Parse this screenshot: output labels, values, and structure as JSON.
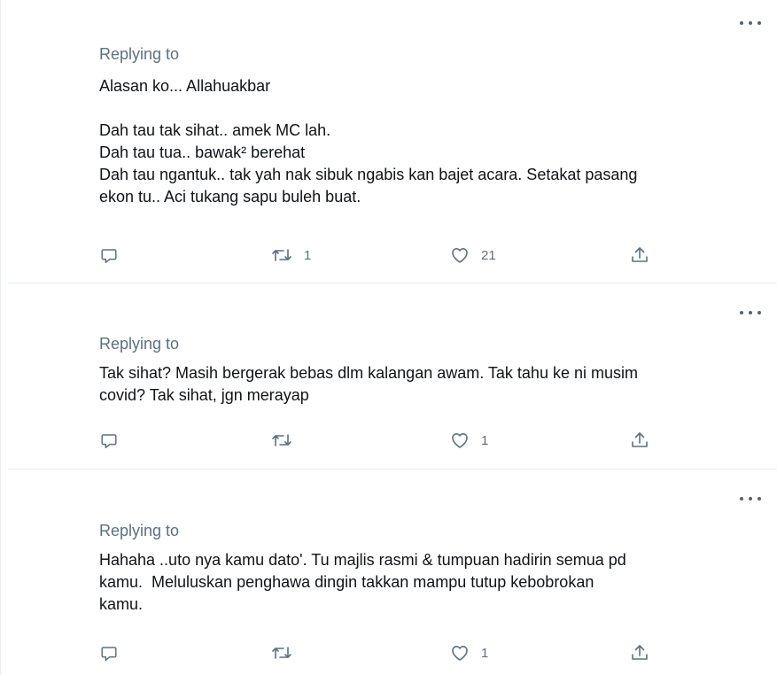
{
  "replies": [
    {
      "replying_to": "Replying to",
      "text": "Alasan ko... Allahuakbar\n\nDah tau tak sihat.. amek MC lah.\nDah tau tua.. bawak² berehat\nDah tau ngantuk.. tak yah nak sibuk ngabis kan bajet acara. Setakat pasang\nekon tu.. Aci tukang sapu buleh buat.",
      "retweets": "1",
      "likes": "21"
    },
    {
      "replying_to": "Replying to",
      "text": "Tak sihat? Masih bergerak bebas dlm kalangan awam. Tak tahu ke ni musim\ncovid? Tak sihat, jgn merayap",
      "retweets": "",
      "likes": "1"
    },
    {
      "replying_to": "Replying to",
      "text": "Hahaha ..uto nya kamu dato'. Tu majlis rasmi & tumpuan hadirin semua pd\nkamu.  Meluluskan penghawa dingin takkan mampu tutup kebobrokan\nkamu.",
      "retweets": "",
      "likes": "1"
    }
  ],
  "icons": {
    "more": "more-horizontal-icon",
    "reply": "reply-bubble-icon",
    "retweet": "retweet-icon",
    "like": "heart-icon",
    "share": "share-upload-icon"
  },
  "colors": {
    "text": "#0f1419",
    "muted": "#5b7083",
    "divider": "#e6ecf0"
  }
}
